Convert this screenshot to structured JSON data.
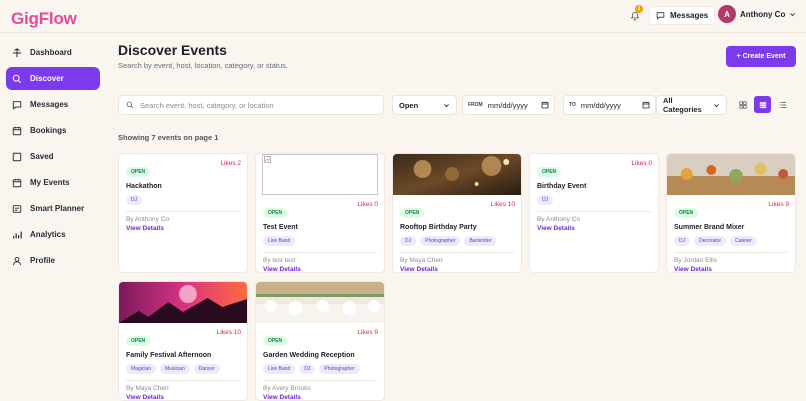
{
  "app": {
    "logo": "GigFlow"
  },
  "topbar": {
    "notification_count": "1",
    "messages_label": "Messages",
    "user_initial": "A",
    "user_name": "Anthony Co"
  },
  "sidebar": {
    "items": [
      {
        "label": "Dashboard",
        "icon": "dashboard-icon",
        "active": false
      },
      {
        "label": "Discover",
        "icon": "search-icon",
        "active": true
      },
      {
        "label": "Messages",
        "icon": "message-icon",
        "active": false
      },
      {
        "label": "Bookings",
        "icon": "calendar-icon",
        "active": false
      },
      {
        "label": "Saved",
        "icon": "bookmark-icon",
        "active": false
      },
      {
        "label": "My Events",
        "icon": "calendar-icon",
        "active": false
      },
      {
        "label": "Smart Planner",
        "icon": "planner-icon",
        "active": false
      },
      {
        "label": "Analytics",
        "icon": "chart-icon",
        "active": false
      },
      {
        "label": "Profile",
        "icon": "user-icon",
        "active": false
      }
    ]
  },
  "header": {
    "title": "Discover Events",
    "subtitle": "Search by event, host, location, category, or status.",
    "create_label": "+ Create Event"
  },
  "filters": {
    "search_placeholder": "Search event, host, category, or location",
    "status_value": "Open",
    "from_label": "FROM",
    "from_value": "mm/dd/yyyy",
    "to_label": "TO",
    "to_value": "mm/dd/yyyy",
    "category_value": "All Categories"
  },
  "results": {
    "summary": "Showing 7 events on page 1"
  },
  "events": [
    {
      "status": "OPEN",
      "likes": "Likes 2",
      "title": "Hackathon",
      "tags": [
        "DJ"
      ],
      "by": "By Anthony Co",
      "view": "View Details",
      "image": "none"
    },
    {
      "status": "OPEN",
      "likes": "Likes 0",
      "title": "Test Event",
      "tags": [
        "Live Band"
      ],
      "by": "By test test",
      "view": "View Details",
      "image": "broken"
    },
    {
      "status": "OPEN",
      "likes": "Likes 10",
      "title": "Rooftop Birthday Party",
      "tags": [
        "DJ",
        "Photographer",
        "Bartender"
      ],
      "by": "By Maya Chen",
      "view": "View Details",
      "image": "party"
    },
    {
      "status": "OPEN",
      "likes": "Likes 0",
      "title": "Birthday Event",
      "tags": [
        "DJ"
      ],
      "by": "By Anthony Co",
      "view": "View Details",
      "image": "none"
    },
    {
      "status": "OPEN",
      "likes": "Likes 9",
      "title": "Summer Brand Mixer",
      "tags": [
        "DJ",
        "Decorator",
        "Caterer"
      ],
      "by": "By Jordan Ellis",
      "view": "View Details",
      "image": "mixer"
    },
    {
      "status": "OPEN",
      "likes": "Likes 10",
      "title": "Family Festival Afternoon",
      "tags": [
        "Magician",
        "Musician",
        "Dancer"
      ],
      "by": "By Maya Chen",
      "view": "View Details",
      "image": "festival"
    },
    {
      "status": "OPEN",
      "likes": "Likes 9",
      "title": "Garden Wedding Reception",
      "tags": [
        "Live Band",
        "DJ",
        "Photographer"
      ],
      "by": "By Avery Brooks",
      "view": "View Details",
      "image": "wedding"
    }
  ],
  "colors": {
    "accent": "#7c3aed",
    "brand": "#e64a9a",
    "likes": "#e11d48",
    "open": "#15803d"
  }
}
